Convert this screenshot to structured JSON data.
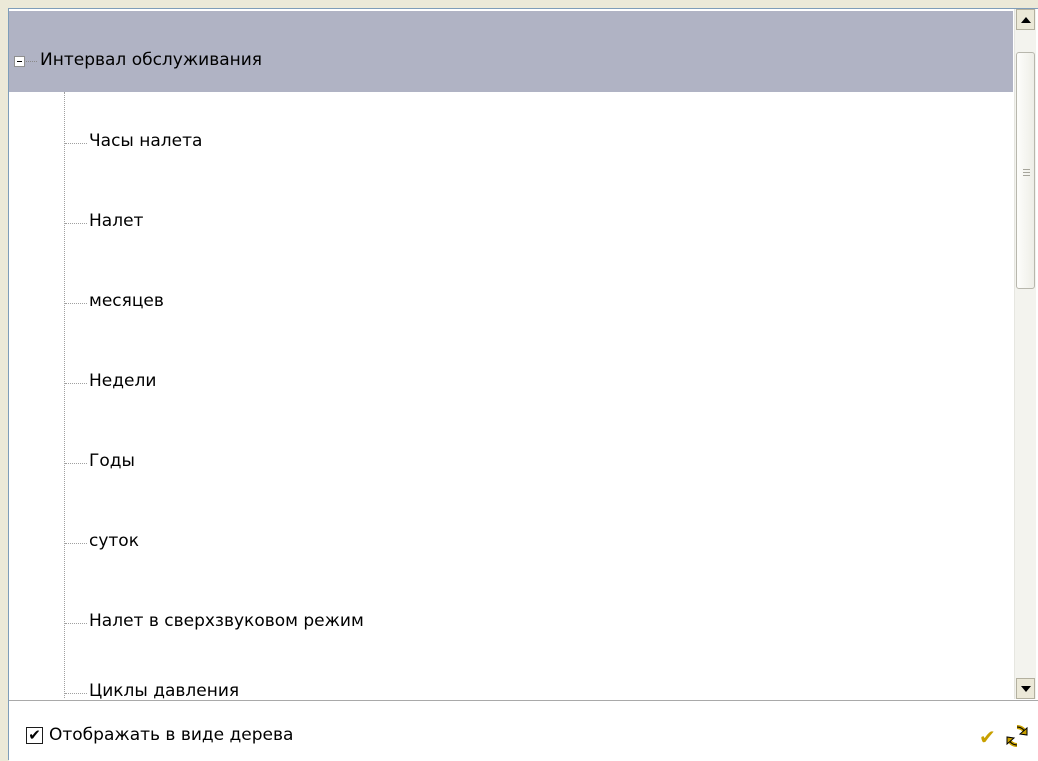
{
  "tree": {
    "root_label": "Интервал обслуживания",
    "nodes": [
      {
        "label": "Часы налета"
      },
      {
        "label": "Налет"
      },
      {
        "label": "месяцев"
      },
      {
        "label": "Недели"
      },
      {
        "label": "Годы"
      },
      {
        "label": "суток"
      },
      {
        "label": "Налет в сверхзвуковом режим"
      },
      {
        "label": "Циклы давления"
      }
    ]
  },
  "footer": {
    "tree_view_checkbox_label": "Отображать в виде дерева",
    "tree_view_checked": true,
    "check_mark": "✔",
    "ok_icon": "checkmark-icon",
    "refresh_icon": "refresh-icon"
  },
  "colors": {
    "selected_row": "#b0b3c4",
    "accent_icon": "#c8a000"
  }
}
